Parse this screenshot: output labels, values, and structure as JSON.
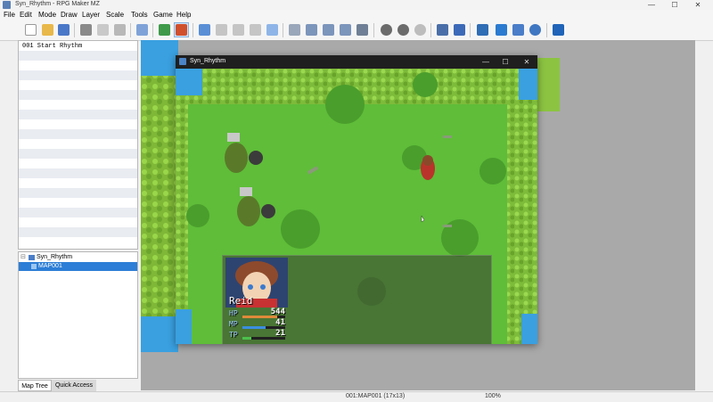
{
  "window": {
    "title": "Syn_Rhythm - RPG Maker MZ",
    "min": "—",
    "max": "☐",
    "close": "✕"
  },
  "menu": [
    "File",
    "Edit",
    "Mode",
    "Draw",
    "Layer",
    "Scale",
    "Tools",
    "Game",
    "Help"
  ],
  "events": {
    "first_row": "001 Start Rhythm"
  },
  "map_tree": {
    "project": "Syn_Rhythm",
    "map": "MAP001",
    "expander": "⊟"
  },
  "bottom_tabs": [
    "Map Tree",
    "Quick Access"
  ],
  "status": {
    "map": "001:MAP001 (17x13)",
    "zoom": "100%"
  },
  "game_window": {
    "title": "Syn_Rhythm",
    "min": "—",
    "max": "☐",
    "close": "✕"
  },
  "actor": {
    "name": "Reid",
    "hp_label": "HP",
    "hp": "544",
    "hp_fill": 0.82,
    "mp_label": "MP",
    "mp": "41",
    "mp_fill": 0.55,
    "tp_label": "TP",
    "tp": "21",
    "tp_fill": 0.21
  },
  "colors": {
    "hp": "#e08a3a",
    "mp": "#3a8ee0",
    "tp": "#4cc04c",
    "grass": "#5fbd39",
    "water": "#3aa0e0"
  }
}
